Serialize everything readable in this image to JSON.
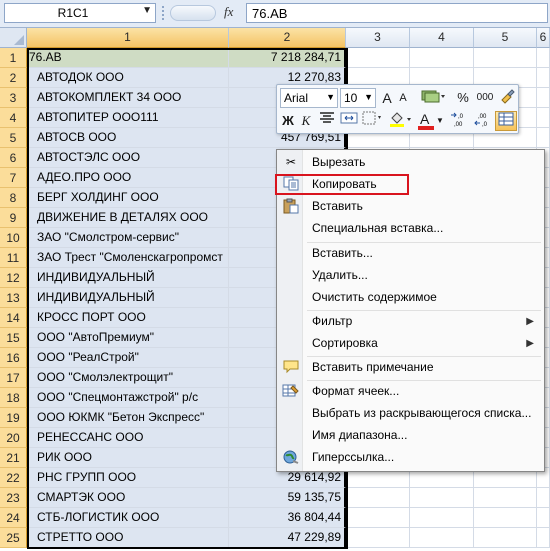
{
  "formula_bar": {
    "name_box": "R1C1",
    "name_box_dropdown": "▼",
    "fx_label": "fx",
    "formula": "76.АВ"
  },
  "columns": [
    "1",
    "2",
    "3",
    "4",
    "5",
    "6"
  ],
  "rows": [
    {
      "num": "1",
      "name": "76.АВ",
      "value": "7 218 284,71"
    },
    {
      "num": "2",
      "name": "АВТОДОК ООО",
      "value": "12 270,83"
    },
    {
      "num": "3",
      "name": "АВТОКОМПЛЕКТ 34 ООО",
      "value": ""
    },
    {
      "num": "4",
      "name": "АВТОПИТЕР ООО111",
      "value": ""
    },
    {
      "num": "5",
      "name": "АВТОСВ ООО",
      "value": "457 769,51"
    },
    {
      "num": "6",
      "name": "АВТОСТЭЛС ООО",
      "value": ""
    },
    {
      "num": "7",
      "name": "АДЕО.ПРО ООО",
      "value": ""
    },
    {
      "num": "8",
      "name": "БЕРГ ХОЛДИНГ ООО",
      "value": ""
    },
    {
      "num": "9",
      "name": "ДВИЖЕНИЕ В ДЕТАЛЯХ ООО",
      "value": ""
    },
    {
      "num": "10",
      "name": "ЗАО \"Смолстром-сервис\"",
      "value": ""
    },
    {
      "num": "11",
      "name": "ЗАО Трест \"Смоленскагропромст",
      "value": ""
    },
    {
      "num": "12",
      "name": "ИНДИВИДУАЛЬНЫЙ",
      "value": ""
    },
    {
      "num": "13",
      "name": "ИНДИВИДУАЛЬНЫЙ",
      "value": ""
    },
    {
      "num": "14",
      "name": "КРОСС ПОРТ ООО",
      "value": ""
    },
    {
      "num": "15",
      "name": "ООО \"АвтоПремиум\"",
      "value": ""
    },
    {
      "num": "16",
      "name": "ООО \"РеалСтрой\"",
      "value": ""
    },
    {
      "num": "17",
      "name": "ООО \"Смолэлектрощит\"",
      "value": ""
    },
    {
      "num": "18",
      "name": "ООО \"Спецмонтажстрой\" р/с",
      "value": ""
    },
    {
      "num": "19",
      "name": "ООО ЮКМК \"Бетон Экспресс\"",
      "value": ""
    },
    {
      "num": "20",
      "name": "РЕНЕССАНС ООО",
      "value": ""
    },
    {
      "num": "21",
      "name": "РИК ООО",
      "value": ""
    },
    {
      "num": "22",
      "name": "РНС ГРУПП ООО",
      "value": "29 614,92"
    },
    {
      "num": "23",
      "name": "СМАРТЭК ООО",
      "value": "59 135,75"
    },
    {
      "num": "24",
      "name": "СТБ-ЛОГИСТИК ООО",
      "value": "36 804,44"
    },
    {
      "num": "25",
      "name": "СТРЕТТО ООО",
      "value": "47 229,89"
    }
  ],
  "mini_toolbar": {
    "font": "Arial",
    "size": "10",
    "grow_font": "A",
    "shrink_font": "A",
    "percent": "%",
    "thousands": "000",
    "bold": "Ж",
    "italic": "К",
    "font_color_letter": "A"
  },
  "context_menu": {
    "cut": "Вырезать",
    "copy": "Копировать",
    "paste": "Вставить",
    "paste_special": "Специальная вставка...",
    "insert": "Вставить...",
    "delete": "Удалить...",
    "clear": "Очистить содержимое",
    "filter": "Фильтр",
    "sort": "Сортировка",
    "insert_comment": "Вставить примечание",
    "format_cells": "Формат ячеек...",
    "pick_from_list": "Выбрать из раскрывающегося списка...",
    "range_name": "Имя диапазона...",
    "hyperlink": "Гиперссылка...",
    "submenu_arrow": "▶"
  },
  "colors": {
    "highlight_box": "#d9141e",
    "selection_fill": "#dde5f1",
    "row_header_selected": "#fbdd9a"
  }
}
